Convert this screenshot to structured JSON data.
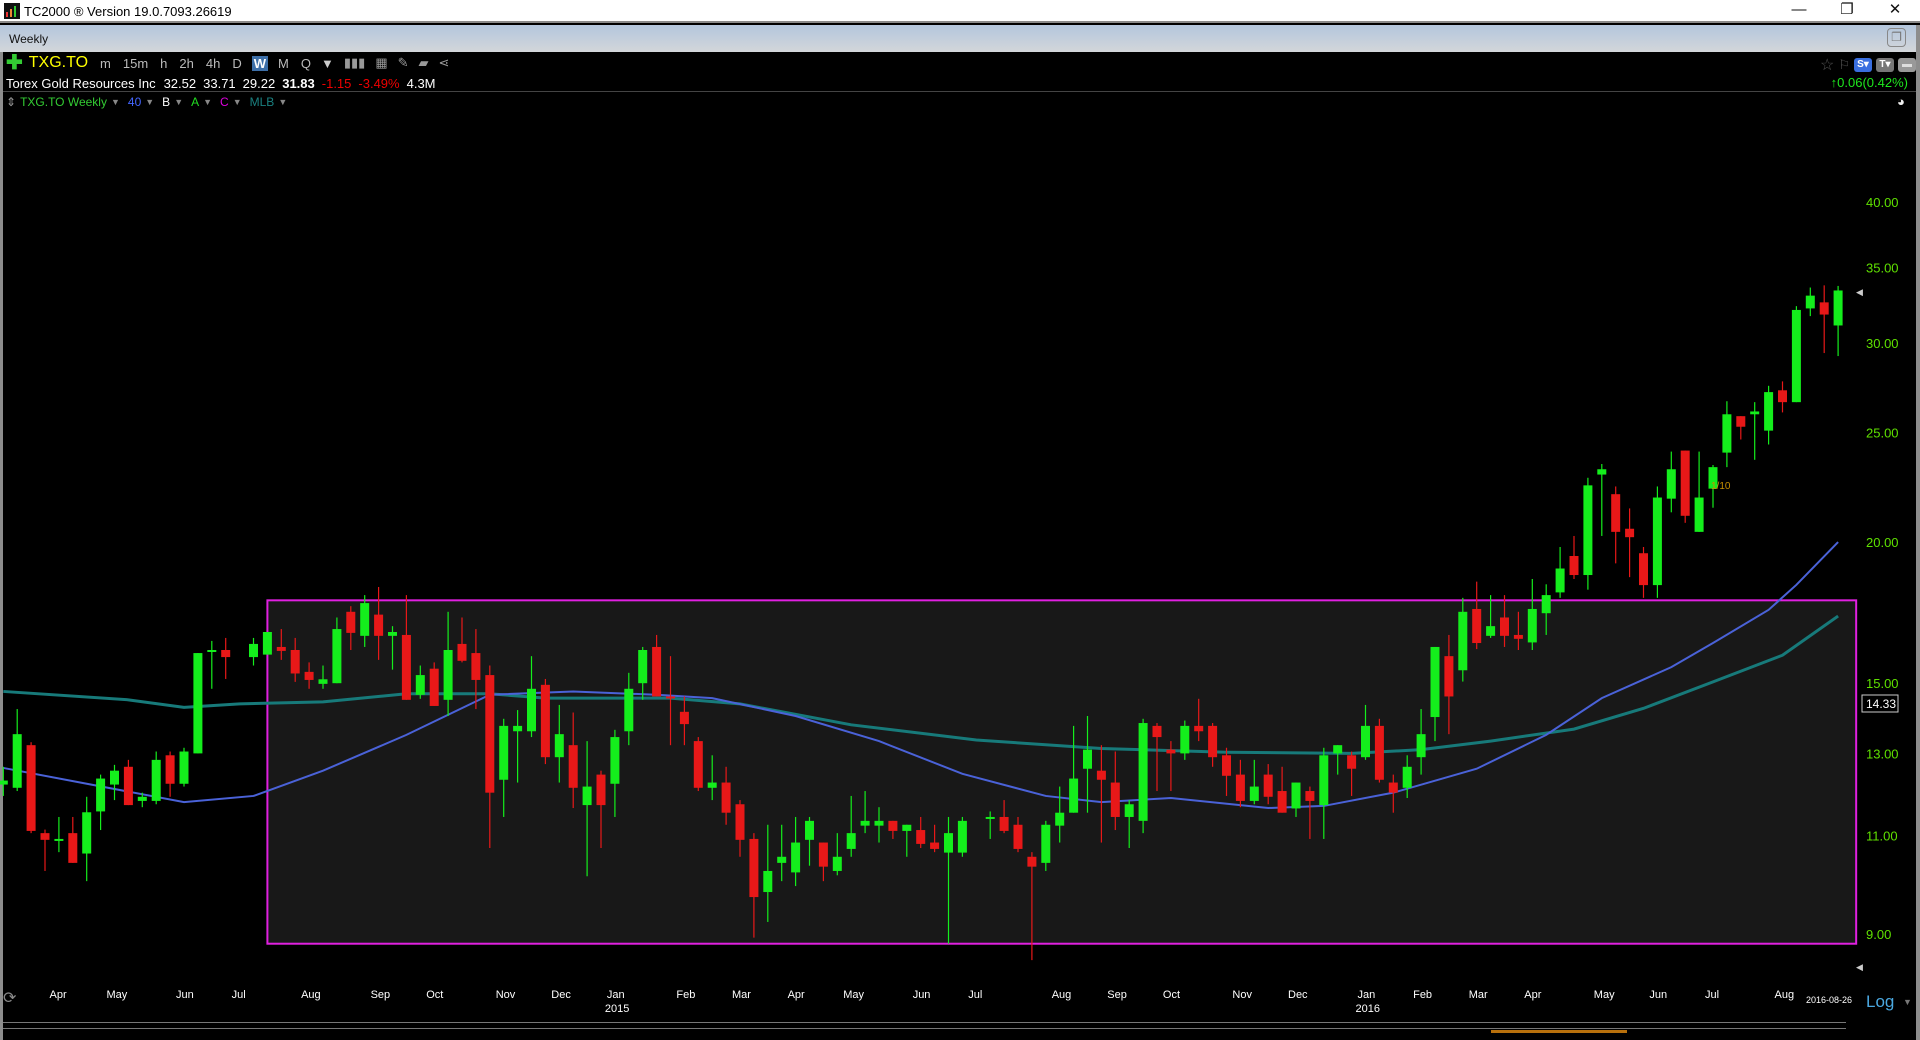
{
  "window": {
    "title": "TC2000 ® Version 19.0.7093.26619",
    "minimize": "—",
    "restore": "❐",
    "close": "✕"
  },
  "tab": {
    "label": "Weekly"
  },
  "toolbar": {
    "symbol": "TXG.TO",
    "timeframes": [
      "m",
      "15m",
      "h",
      "2h",
      "4h",
      "D",
      "W",
      "M",
      "Q"
    ],
    "selected": "W"
  },
  "quote": {
    "name": "Torex Gold Resources Inc",
    "open": "32.52",
    "high": "33.71",
    "low": "29.22",
    "close": "31.83",
    "change": "-1.15",
    "change_pct": "-3.49%",
    "volume": "4.3M",
    "after_change": "0.06(0.42%)"
  },
  "indicators": {
    "chart": "TXG.TO Weekly",
    "ma": "40",
    "b": "B",
    "a": "A",
    "c": "C",
    "mlb": "MLB"
  },
  "colors": {
    "up": "#14ee1c",
    "down": "#e81818",
    "ma_short": "#4a62d8",
    "ma_long": "#177a7a",
    "box": "#e020e0",
    "axis": "#5fe000"
  },
  "chart_data": {
    "type": "candlestick",
    "scale": "Log",
    "ylim": [
      8.4,
      44
    ],
    "yticks": [
      "40.00",
      "35.00",
      "30.00",
      "25.00",
      "20.00",
      "15.00",
      "13.00",
      "11.00",
      "9.00"
    ],
    "current_label": "14.33",
    "last_date": "2016-08-26",
    "annotation": "1/10",
    "xlabels": [
      [
        "Apr",
        3.9
      ],
      [
        "May",
        8
      ],
      [
        "Jun",
        13
      ],
      [
        "Jul",
        17
      ],
      [
        "Aug",
        22
      ],
      [
        "Sep",
        27
      ],
      [
        "Oct",
        31
      ],
      [
        "Nov",
        36
      ],
      [
        "Dec",
        40
      ],
      [
        "Jan",
        44
      ],
      [
        "Feb",
        49
      ],
      [
        "Mar",
        53
      ],
      [
        "Apr",
        57
      ],
      [
        "May",
        61
      ],
      [
        "Jun",
        66
      ],
      [
        "Jul",
        70
      ],
      [
        "Aug",
        76
      ],
      [
        "Sep",
        80
      ],
      [
        "Oct",
        84
      ],
      [
        "Nov",
        89
      ],
      [
        "Dec",
        93
      ],
      [
        "Jan",
        98
      ],
      [
        "Feb",
        102
      ],
      [
        "Mar",
        106
      ],
      [
        "Apr",
        110
      ],
      [
        "May",
        115
      ],
      [
        "Jun",
        119
      ],
      [
        "Jul",
        123
      ],
      [
        "Aug",
        128
      ]
    ],
    "years": [
      [
        "2015",
        44
      ],
      [
        "2016",
        98
      ]
    ],
    "box": {
      "from_week": 19,
      "to_week": 133.3,
      "low": 8.82,
      "high": 17.76
    },
    "ohlc": [
      [
        12.2,
        12.65,
        11.92,
        12.3
      ],
      [
        12.12,
        14.23,
        12.04,
        13.52
      ],
      [
        13.22,
        13.3,
        11.05,
        11.1
      ],
      [
        11.05,
        11.13,
        10.23,
        10.9
      ],
      [
        10.9,
        11.42,
        10.63,
        10.92
      ],
      [
        11.05,
        11.42,
        10.4,
        10.4
      ],
      [
        10.6,
        11.9,
        10.02,
        11.53
      ],
      [
        11.55,
        12.45,
        11.12,
        12.35
      ],
      [
        12.2,
        12.7,
        11.82,
        12.55
      ],
      [
        12.65,
        12.83,
        11.7,
        11.7
      ],
      [
        11.8,
        12.0,
        11.65,
        11.9
      ],
      [
        11.8,
        13.05,
        11.72,
        12.83
      ],
      [
        12.95,
        13.05,
        11.9,
        12.22
      ],
      [
        12.22,
        13.15,
        12.15,
        13.05
      ],
      [
        13.0,
        15.95,
        13.0,
        15.95
      ],
      [
        16.0,
        16.35,
        14.83,
        16.05
      ],
      [
        16.05,
        16.45,
        15.13,
        15.82
      ],
      null,
      [
        15.82,
        16.45,
        15.55,
        16.25
      ],
      [
        15.9,
        16.65,
        15.9,
        16.65
      ],
      [
        16.15,
        16.75,
        15.73,
        16.02
      ],
      [
        16.05,
        16.45,
        15.04,
        15.3
      ],
      [
        15.35,
        15.65,
        14.83,
        15.1
      ],
      [
        14.98,
        15.55,
        14.83,
        15.12
      ],
      [
        15.0,
        17.15,
        15.0,
        16.75
      ],
      [
        17.35,
        17.55,
        16.05,
        16.62
      ],
      [
        16.52,
        17.95,
        16.15,
        17.66
      ],
      [
        17.25,
        18.25,
        15.73,
        16.52
      ],
      [
        16.52,
        16.85,
        15.42,
        16.65
      ],
      [
        16.55,
        17.95,
        14.5,
        14.5
      ],
      [
        14.65,
        15.55,
        14.53,
        15.25
      ],
      [
        15.45,
        15.65,
        14.32,
        14.32
      ],
      [
        14.5,
        17.35,
        14.03,
        16.05
      ],
      [
        16.25,
        17.15,
        15.65,
        15.7
      ],
      [
        15.95,
        16.75,
        14.23,
        15.1
      ],
      [
        15.25,
        15.55,
        10.72,
        12.0
      ],
      [
        12.32,
        13.95,
        11.42,
        13.75
      ],
      [
        13.6,
        14.2,
        12.25,
        13.75
      ],
      [
        13.6,
        15.85,
        13.44,
        14.83
      ],
      [
        14.95,
        15.13,
        12.72,
        12.9
      ],
      [
        12.9,
        14.35,
        12.25,
        13.52
      ],
      [
        13.22,
        14.13,
        11.63,
        12.12
      ],
      [
        11.7,
        13.33,
        10.12,
        12.15
      ],
      [
        12.45,
        12.55,
        10.72,
        11.7
      ],
      [
        12.22,
        13.64,
        11.42,
        13.44
      ],
      [
        13.6,
        15.32,
        13.22,
        14.83
      ],
      [
        15.0,
        16.15,
        14.5,
        16.05
      ],
      [
        16.15,
        16.55,
        14.6,
        14.6
      ],
      [
        14.6,
        15.85,
        13.22,
        14.55
      ],
      [
        14.15,
        14.6,
        13.22,
        13.8
      ],
      [
        13.33,
        13.44,
        12.04,
        12.12
      ],
      [
        12.12,
        12.95,
        11.82,
        12.25
      ],
      [
        12.25,
        12.65,
        11.24,
        11.52
      ],
      [
        11.72,
        11.82,
        10.53,
        10.9
      ],
      [
        10.92,
        11.05,
        8.93,
        9.7
      ],
      [
        9.8,
        11.24,
        9.22,
        10.23
      ],
      [
        10.4,
        11.24,
        10.02,
        10.53
      ],
      [
        10.2,
        11.42,
        9.92,
        10.84
      ],
      [
        10.9,
        11.42,
        10.34,
        11.33
      ],
      [
        10.84,
        10.84,
        10.02,
        10.32
      ],
      [
        10.23,
        11.05,
        10.14,
        10.53
      ],
      [
        10.7,
        11.92,
        10.53,
        11.05
      ],
      [
        11.22,
        12.04,
        11.05,
        11.33
      ],
      [
        11.22,
        11.65,
        10.84,
        11.33
      ],
      [
        11.33,
        11.33,
        10.92,
        11.1
      ],
      [
        11.1,
        11.24,
        10.53,
        11.24
      ],
      [
        11.12,
        11.42,
        10.72,
        10.81
      ],
      [
        10.84,
        11.24,
        10.63,
        10.7
      ],
      [
        10.62,
        11.42,
        8.82,
        11.05
      ],
      [
        10.62,
        11.42,
        10.53,
        11.33
      ],
      null,
      [
        11.38,
        11.55,
        10.92,
        11.42
      ],
      [
        11.42,
        11.82,
        11.05,
        11.1
      ],
      [
        11.24,
        11.42,
        10.63,
        10.7
      ],
      [
        10.53,
        10.63,
        8.53,
        10.32
      ],
      [
        10.4,
        11.33,
        10.23,
        11.24
      ],
      [
        11.22,
        12.15,
        10.84,
        11.52
      ],
      [
        11.52,
        13.75,
        11.52,
        12.35
      ],
      [
        12.6,
        14.03,
        11.52,
        13.1
      ],
      [
        12.55,
        13.22,
        10.84,
        12.32
      ],
      [
        12.25,
        13.05,
        11.12,
        11.42
      ],
      [
        11.42,
        11.82,
        10.72,
        11.72
      ],
      [
        11.33,
        13.95,
        11.05,
        13.83
      ],
      [
        13.75,
        13.83,
        12.04,
        13.44
      ],
      [
        13.1,
        13.33,
        12.04,
        13.0
      ],
      [
        13.0,
        13.9,
        12.83,
        13.75
      ],
      [
        13.75,
        14.53,
        13.33,
        13.6
      ],
      [
        13.75,
        13.83,
        12.65,
        12.9
      ],
      [
        12.95,
        13.15,
        11.92,
        12.42
      ],
      [
        12.45,
        12.83,
        11.65,
        11.8
      ],
      [
        11.8,
        12.83,
        11.72,
        12.15
      ],
      [
        12.45,
        12.72,
        11.72,
        11.9
      ],
      [
        12.04,
        12.65,
        11.52,
        11.52
      ],
      [
        11.62,
        12.25,
        11.42,
        12.25
      ],
      [
        12.04,
        12.15,
        10.92,
        11.8
      ],
      [
        11.7,
        13.15,
        10.92,
        12.95
      ],
      [
        13.0,
        13.22,
        12.45,
        13.22
      ],
      [
        12.95,
        13.05,
        11.92,
        12.6
      ],
      [
        12.9,
        14.35,
        12.83,
        13.75
      ],
      [
        13.75,
        13.95,
        12.25,
        12.32
      ],
      [
        12.25,
        12.45,
        11.52,
        12.0
      ],
      [
        12.12,
        12.95,
        11.87,
        12.65
      ],
      [
        12.9,
        14.23,
        12.45,
        13.52
      ],
      [
        14.0,
        16.15,
        13.33,
        16.15
      ],
      [
        15.85,
        16.55,
        13.52,
        14.6
      ],
      [
        15.4,
        17.85,
        15.05,
        17.35
      ],
      [
        17.45,
        18.45,
        16.08,
        16.28
      ],
      [
        16.52,
        17.95,
        16.45,
        16.85
      ],
      [
        17.15,
        17.95,
        16.15,
        16.52
      ],
      [
        16.55,
        17.35,
        16.05,
        16.42
      ],
      [
        16.3,
        18.55,
        16.05,
        17.45
      ],
      [
        17.3,
        18.35,
        16.55,
        17.95
      ],
      [
        18.05,
        19.8,
        17.85,
        18.95
      ],
      [
        19.44,
        20.25,
        18.55,
        18.7
      ],
      [
        18.7,
        22.8,
        18.15,
        22.45
      ],
      [
        22.95,
        23.45,
        20.25,
        23.2
      ],
      [
        22.05,
        22.4,
        19.15,
        20.42
      ],
      [
        20.55,
        21.42,
        18.62,
        20.2
      ],
      [
        19.55,
        19.8,
        17.85,
        18.32
      ],
      [
        18.32,
        22.4,
        17.85,
        21.9
      ],
      [
        21.85,
        24.05,
        21.25,
        23.2
      ],
      [
        24.1,
        24.1,
        20.8,
        21.1
      ],
      [
        20.42,
        24.05,
        20.42,
        21.9
      ],
      [
        22.3,
        23.4,
        21.45,
        23.3
      ],
      [
        24.0,
        26.65,
        23.3,
        25.95
      ],
      [
        25.85,
        25.85,
        24.65,
        25.3
      ],
      [
        25.95,
        26.6,
        23.65,
        26.1
      ],
      [
        25.1,
        27.5,
        24.4,
        27.15
      ],
      [
        27.25,
        27.75,
        26.05,
        26.6
      ],
      [
        26.6,
        32.35,
        26.6,
        32.1
      ],
      [
        32.2,
        33.6,
        31.7,
        33.05
      ],
      [
        32.6,
        33.75,
        29.4,
        31.8
      ],
      [
        31.1,
        33.71,
        29.22,
        33.4
      ]
    ],
    "ma_short": [
      [
        0,
        12.62
      ],
      [
        13,
        11.77
      ],
      [
        18,
        11.92
      ],
      [
        23,
        12.55
      ],
      [
        29,
        13.5
      ],
      [
        35,
        14.65
      ],
      [
        41,
        14.75
      ],
      [
        47,
        14.65
      ],
      [
        51,
        14.55
      ],
      [
        57,
        14.03
      ],
      [
        63,
        13.33
      ],
      [
        69,
        12.47
      ],
      [
        75,
        11.92
      ],
      [
        79,
        11.77
      ],
      [
        84,
        11.87
      ],
      [
        91,
        11.63
      ],
      [
        95,
        11.68
      ],
      [
        100,
        12.0
      ],
      [
        106,
        12.6
      ],
      [
        111,
        13.5
      ],
      [
        115,
        14.55
      ],
      [
        120,
        15.5
      ],
      [
        123,
        16.28
      ],
      [
        127,
        17.42
      ],
      [
        129,
        18.33
      ],
      [
        132,
        20.0
      ]
    ],
    "ma_long": [
      [
        0,
        14.75
      ],
      [
        9,
        14.5
      ],
      [
        13,
        14.28
      ],
      [
        17,
        14.38
      ],
      [
        23,
        14.44
      ],
      [
        29,
        14.68
      ],
      [
        35,
        14.68
      ],
      [
        39,
        14.55
      ],
      [
        48,
        14.55
      ],
      [
        53,
        14.38
      ],
      [
        61,
        13.78
      ],
      [
        70,
        13.36
      ],
      [
        79,
        13.13
      ],
      [
        88,
        13.03
      ],
      [
        97,
        13.0
      ],
      [
        102,
        13.1
      ],
      [
        107,
        13.33
      ],
      [
        113,
        13.66
      ],
      [
        118,
        14.25
      ],
      [
        123,
        15.04
      ],
      [
        128,
        15.88
      ],
      [
        132,
        17.2
      ]
    ]
  },
  "axis": {
    "log_label": "Log"
  }
}
